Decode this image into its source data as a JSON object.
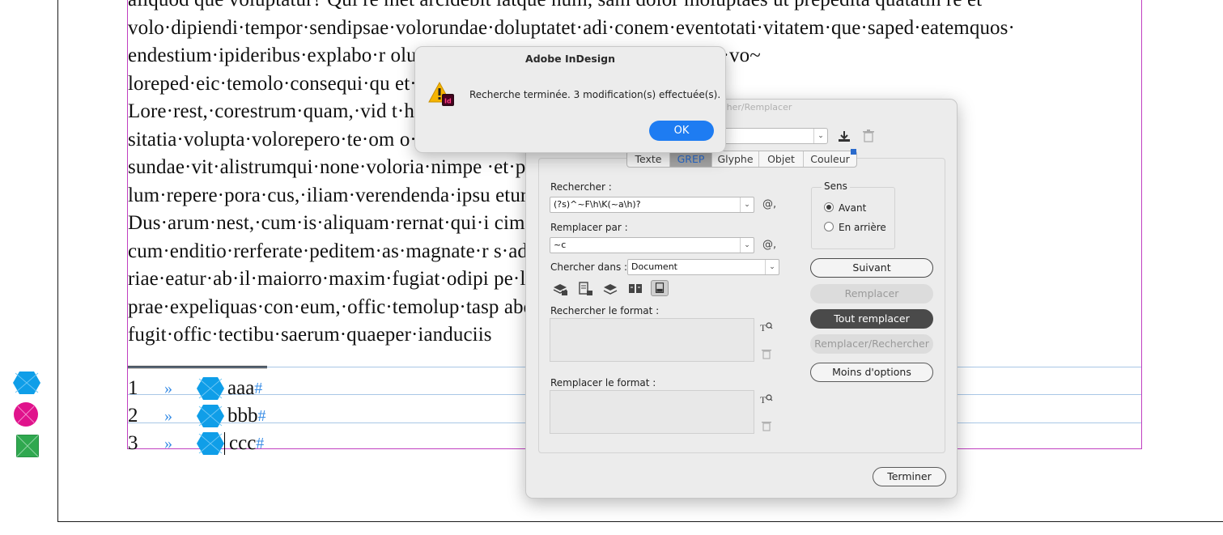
{
  "document": {
    "paragraphs": [
      "aliquod que voluptatur? Qui re met arcidebit iatque num, sam dolor moluptaes ut prepedita quatatin re et·",
      "volo·dipiendi·tempor·sendipsae·volorundae·doluptatet·adi·conem·eventotati·vitatem·que·saped·eatemquos·",
      "endestium·ipideribus·explabo·r                                                                       olum·sed·quissit·aquibus,·ut·fugit·quam·vo~",
      "loreped·eic·temolo·consequi·qu                                                                       et·lat.",
      "Lore·rest,·corestrum·quam,·vid                                                                              t·hillabore,·arcipis·",
      "sitatia·volupta·volorepero·te·om                                                                             o·eatem·voluptur·",
      "sundae·vit·alistrumqui·none·voloria·nimpe                                                                    ·et·praeperum·vo~",
      "lum·repere·pora·cus,·iliam·verendenda·ipsu                                                                   etur?",
      "Dus·arum·nest,·cum·is·aliquam·rernat·qui·i                                                                   cimi,·eatem·que·",
      "cum·enditio·rerferate·peditem·as·magnate·r                                                                   s·ad·mi,·qui·dolo~",
      "riae·eatur·ab·il·maiorro·maxim·fugiat·odipi                                                                  pe·litatiis·a·pos·ace~",
      "prae·expeliquas·con·eum,·offic·temolup·tasp                                                                  abor·aturio·ipsam·",
      "fugit·offic·tectibu·saerum·quaeper·ianduciis"
    ],
    "pilcrow": "¶",
    "footnotes": [
      {
        "num": "1",
        "tab": "»",
        "text": "aaa",
        "hash": "#"
      },
      {
        "num": "2",
        "tab": "»",
        "text": "bbb",
        "hash": "#"
      },
      {
        "num": "3",
        "tab": "»",
        "text": "ccc",
        "hash": "#"
      }
    ]
  },
  "find_replace": {
    "title": "Rechercher/Remplacer",
    "tabs": [
      "Texte",
      "GREP",
      "Glyphe",
      "Objet",
      "Couleur"
    ],
    "active_tab": "GREP",
    "search_label": "Rechercher :",
    "search_value": "(?s)^~F\\h\\K(~a\\h)?",
    "replace_label": "Remplacer par :",
    "replace_value": "~c",
    "at_symbol": "@,",
    "search_in_label": "Chercher dans :",
    "search_in_value": "Document",
    "find_format_label": "Rechercher le format :",
    "replace_format_label": "Remplacer le format :",
    "direction_title": "Sens",
    "direction_forward": "Avant",
    "direction_backward": "En arrière",
    "btn_next": "Suivant",
    "btn_replace": "Remplacer",
    "btn_replace_all": "Tout remplacer",
    "btn_replace_find": "Remplacer/Rechercher",
    "btn_fewer": "Moins d'options",
    "btn_done": "Terminer"
  },
  "alert": {
    "title": "Adobe InDesign",
    "message": "Recherche terminée.  3 modification(s) effectuée(s).",
    "ok": "OK",
    "icon_badge": "Id"
  },
  "colors": {
    "accent_blue": "#1e7cf2",
    "hex_shape": "#0f9ee8",
    "magenta_shape": "#e0138c",
    "green_shape": "#2fa84f",
    "frame_magenta": "#c040c0",
    "invisibles_blue": "#3a8ee6"
  }
}
